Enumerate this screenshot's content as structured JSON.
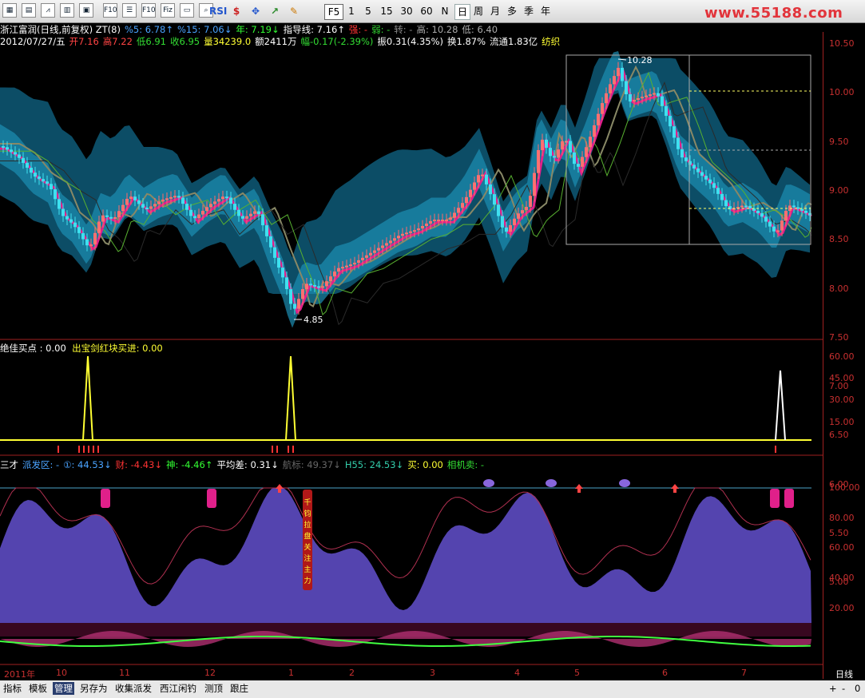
{
  "toolbar": {
    "buttons": [
      {
        "name": "grid-icon",
        "label": "▦"
      },
      {
        "name": "table-icon",
        "label": "▤"
      },
      {
        "name": "line-chart-icon",
        "label": "⩘"
      },
      {
        "name": "bar-chart-icon",
        "label": "▥"
      },
      {
        "name": "image-icon",
        "label": "▣"
      },
      {
        "name": "f10-button",
        "label": "F10"
      },
      {
        "name": "list-icon",
        "label": "☰"
      },
      {
        "name": "f10b-button",
        "label": "F10"
      },
      {
        "name": "fiz-button",
        "label": "Fiz"
      },
      {
        "name": "doc-icon",
        "label": "▭"
      },
      {
        "name": "zoom-icon",
        "label": "⌕"
      }
    ],
    "indicators": [
      "RSI",
      "$",
      "✥",
      "↗",
      "✎"
    ],
    "periods": [
      "F5",
      "1",
      "5",
      "15",
      "30",
      "60",
      "N",
      "日",
      "周",
      "月",
      "多",
      "季",
      "年"
    ],
    "selected_period": "日",
    "logo": "www.55188.com"
  },
  "header": {
    "line1": [
      {
        "t": "浙江富润(日线,前复权) ZT(8)",
        "c": "#ffffff"
      },
      {
        "t": "%5: 6.78↑",
        "c": "#4aa3ff"
      },
      {
        "t": "%15: 7.06↓",
        "c": "#4aa3ff"
      },
      {
        "t": "年: 7.19↓",
        "c": "#33ff33"
      },
      {
        "t": "指导线: 7.16↑",
        "c": "#ffffff"
      },
      {
        "t": "强: -",
        "c": "#ff3333"
      },
      {
        "t": "弱: -",
        "c": "#33dd33"
      },
      {
        "t": "转: -",
        "c": "#888888"
      },
      {
        "t": "高: 10.28",
        "c": "#aaaaaa"
      },
      {
        "t": "低: 6.40",
        "c": "#aaaaaa"
      }
    ],
    "line2": [
      {
        "t": "2012/07/27/五",
        "c": "#ffffff"
      },
      {
        "t": "开7.16",
        "c": "#ff4444"
      },
      {
        "t": "高7.22",
        "c": "#ff4444"
      },
      {
        "t": "低6.91",
        "c": "#33dd33"
      },
      {
        "t": "收6.95",
        "c": "#33dd33"
      },
      {
        "t": "量34239.0",
        "c": "#ffff33"
      },
      {
        "t": "额2411万",
        "c": "#ffffff"
      },
      {
        "t": "幅-0.17(-2.39%)",
        "c": "#33dd33"
      },
      {
        "t": "振0.31(4.35%)",
        "c": "#ffffff"
      },
      {
        "t": "换1.87%",
        "c": "#ffffff"
      },
      {
        "t": "流通1.83亿",
        "c": "#ffffff"
      },
      {
        "t": "纺织",
        "c": "#ffff33"
      }
    ]
  },
  "price_axis": [
    "10.50",
    "10.00",
    "9.50",
    "9.00",
    "8.50",
    "8.00",
    "7.50",
    "7.00",
    "6.50",
    "6.00",
    "5.50",
    "5.00"
  ],
  "annotations": {
    "high": "10.28",
    "low": "4.85"
  },
  "mid_panel": {
    "label1": "绝佳买点 : 0.00",
    "label2": "出宝剑红块买进: 0.00",
    "axis": [
      "60.00",
      "45.00",
      "30.00",
      "15.00"
    ]
  },
  "low_panel": {
    "items": [
      {
        "t": "三才",
        "c": "#ffffff"
      },
      {
        "t": "派发区: -",
        "c": "#4aa3ff"
      },
      {
        "t": "①: 44.53↓",
        "c": "#4aa3ff"
      },
      {
        "t": "财: -4.43↓",
        "c": "#ff3333"
      },
      {
        "t": "神: -4.46↑",
        "c": "#33ff33"
      },
      {
        "t": "平均差: 0.31↓",
        "c": "#ffffff"
      },
      {
        "t": "航标: 49.37↓",
        "c": "#666666"
      },
      {
        "t": "H55: 24.53↓",
        "c": "#33ccaa"
      },
      {
        "t": "买: 0.00",
        "c": "#ffff33"
      },
      {
        "t": "相机卖: -",
        "c": "#33dd33"
      }
    ],
    "axis": [
      "100.00",
      "80.00",
      "60.00",
      "40.00",
      "20.00"
    ],
    "banner": "千钧拉盘关注主力"
  },
  "time_axis": [
    "2011年",
    "10",
    "11",
    "12",
    "1",
    "2",
    "3",
    "4",
    "5",
    "6",
    "7"
  ],
  "time_axis_right": "日线",
  "bottom_tabs": [
    "指标",
    "模板",
    "管理",
    "另存为",
    "收集派发",
    "西江闲钓",
    "测顶",
    "跟庄"
  ],
  "bottom_active": "管理",
  "bottom_right": [
    "+",
    "-",
    "0"
  ]
}
